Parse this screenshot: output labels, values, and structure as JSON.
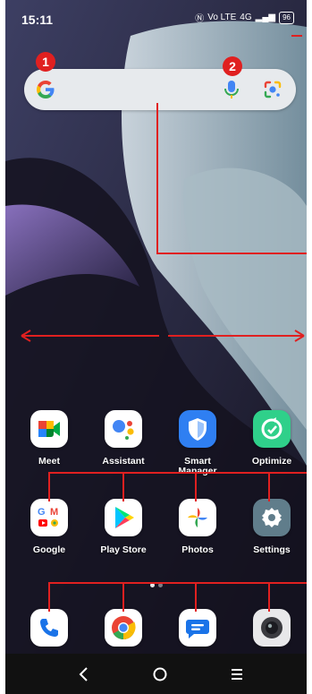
{
  "status_bar": {
    "time": "15:11",
    "network_label": "Vo LTE",
    "signal_label": "4G",
    "battery": "96"
  },
  "search_bar": {
    "google_icon": "google-g-icon",
    "mic_icon": "microphone-icon",
    "lens_icon": "google-lens-icon"
  },
  "markers": {
    "one": "1",
    "two": "2"
  },
  "apps_row1": [
    {
      "label": "Meet",
      "icon": "google-meet-icon"
    },
    {
      "label": "Assistant",
      "icon": "google-assistant-icon"
    },
    {
      "label": "Smart Manager",
      "icon": "shield-icon"
    },
    {
      "label": "Optimize",
      "icon": "optimize-icon"
    }
  ],
  "apps_row2": [
    {
      "label": "Google",
      "icon": "google-folder-icon"
    },
    {
      "label": "Play Store",
      "icon": "play-store-icon"
    },
    {
      "label": "Photos",
      "icon": "google-photos-icon"
    },
    {
      "label": "Settings",
      "icon": "settings-icon"
    }
  ],
  "dock": [
    {
      "icon": "phone-icon"
    },
    {
      "icon": "chrome-icon"
    },
    {
      "icon": "messages-icon"
    },
    {
      "icon": "camera-icon"
    }
  ],
  "nav": {
    "back_icon": "back-icon",
    "home_icon": "home-icon",
    "menu_icon": "menu-icon"
  },
  "colors": {
    "annotation": "#e02020",
    "search_bg": "#e7eaed"
  }
}
